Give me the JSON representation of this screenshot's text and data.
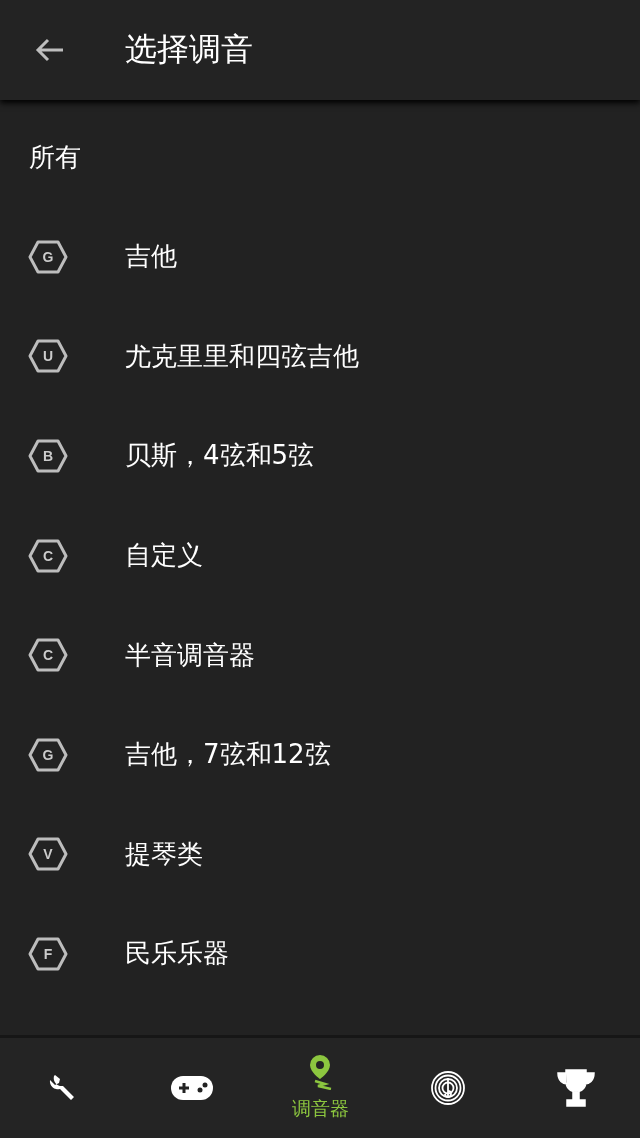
{
  "header": {
    "title": "选择调音"
  },
  "list": {
    "section": "所有",
    "items": [
      {
        "badge": "G",
        "label": "吉他"
      },
      {
        "badge": "U",
        "label": "尤克里里和四弦吉他"
      },
      {
        "badge": "B",
        "label": "贝斯，4弦和5弦"
      },
      {
        "badge": "C",
        "label": "自定义"
      },
      {
        "badge": "C",
        "label": "半音调音器"
      },
      {
        "badge": "G",
        "label": "吉他，7弦和12弦"
      },
      {
        "badge": "V",
        "label": "提琴类"
      },
      {
        "badge": "F",
        "label": "民乐乐器"
      }
    ]
  },
  "bottom_nav": [
    {
      "kind": "wrench",
      "selected": false
    },
    {
      "kind": "gamepad",
      "selected": false
    },
    {
      "kind": "pin",
      "selected": true,
      "label": "调音器"
    },
    {
      "kind": "fingerprint",
      "selected": false
    },
    {
      "kind": "trophy",
      "selected": false
    }
  ]
}
